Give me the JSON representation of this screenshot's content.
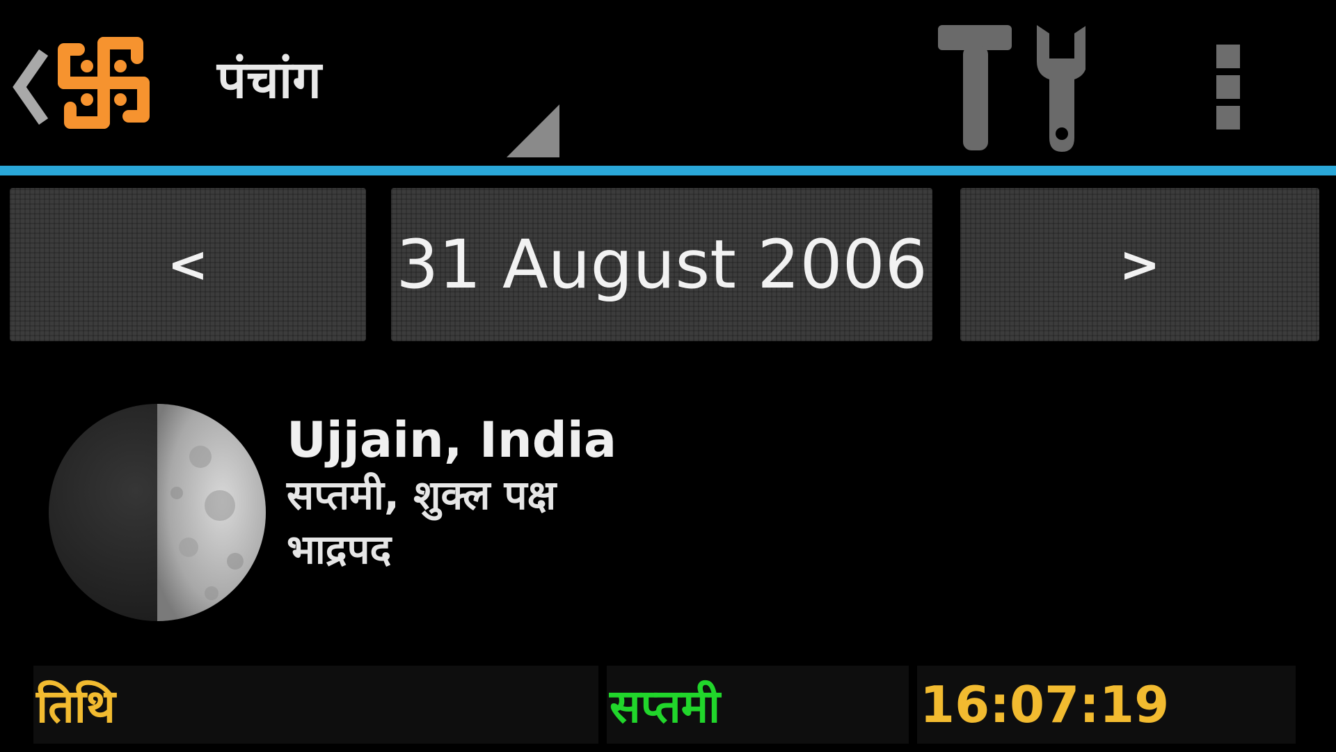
{
  "app": {
    "title": "पंचांग",
    "accent_color": "#2aa7d8",
    "logo_color": "#f6932f"
  },
  "actionbar": {
    "up_icon": "chevron-left-icon",
    "logo_icon": "swastika-logo-icon",
    "spinner_icon": "dropdown-triangle-icon",
    "tools_icon": "tools-icon",
    "overflow_icon": "overflow-menu-icon"
  },
  "date_nav": {
    "prev_label": "<",
    "date_label": "31 August 2006",
    "next_label": ">"
  },
  "moon": {
    "phase_icon": "moon-phase-icon",
    "illuminated_fraction": 0.5
  },
  "info": {
    "location": "Ujjain, India",
    "tithi_paksha": "सप्तमी, शुक्ल पक्ष",
    "month": "भाद्रपद"
  },
  "panchang_row": {
    "label": "तिथि",
    "value": "सप्तमी",
    "time": "16:07:19",
    "label_color": "#f2bb30",
    "value_color": "#21d62b"
  }
}
